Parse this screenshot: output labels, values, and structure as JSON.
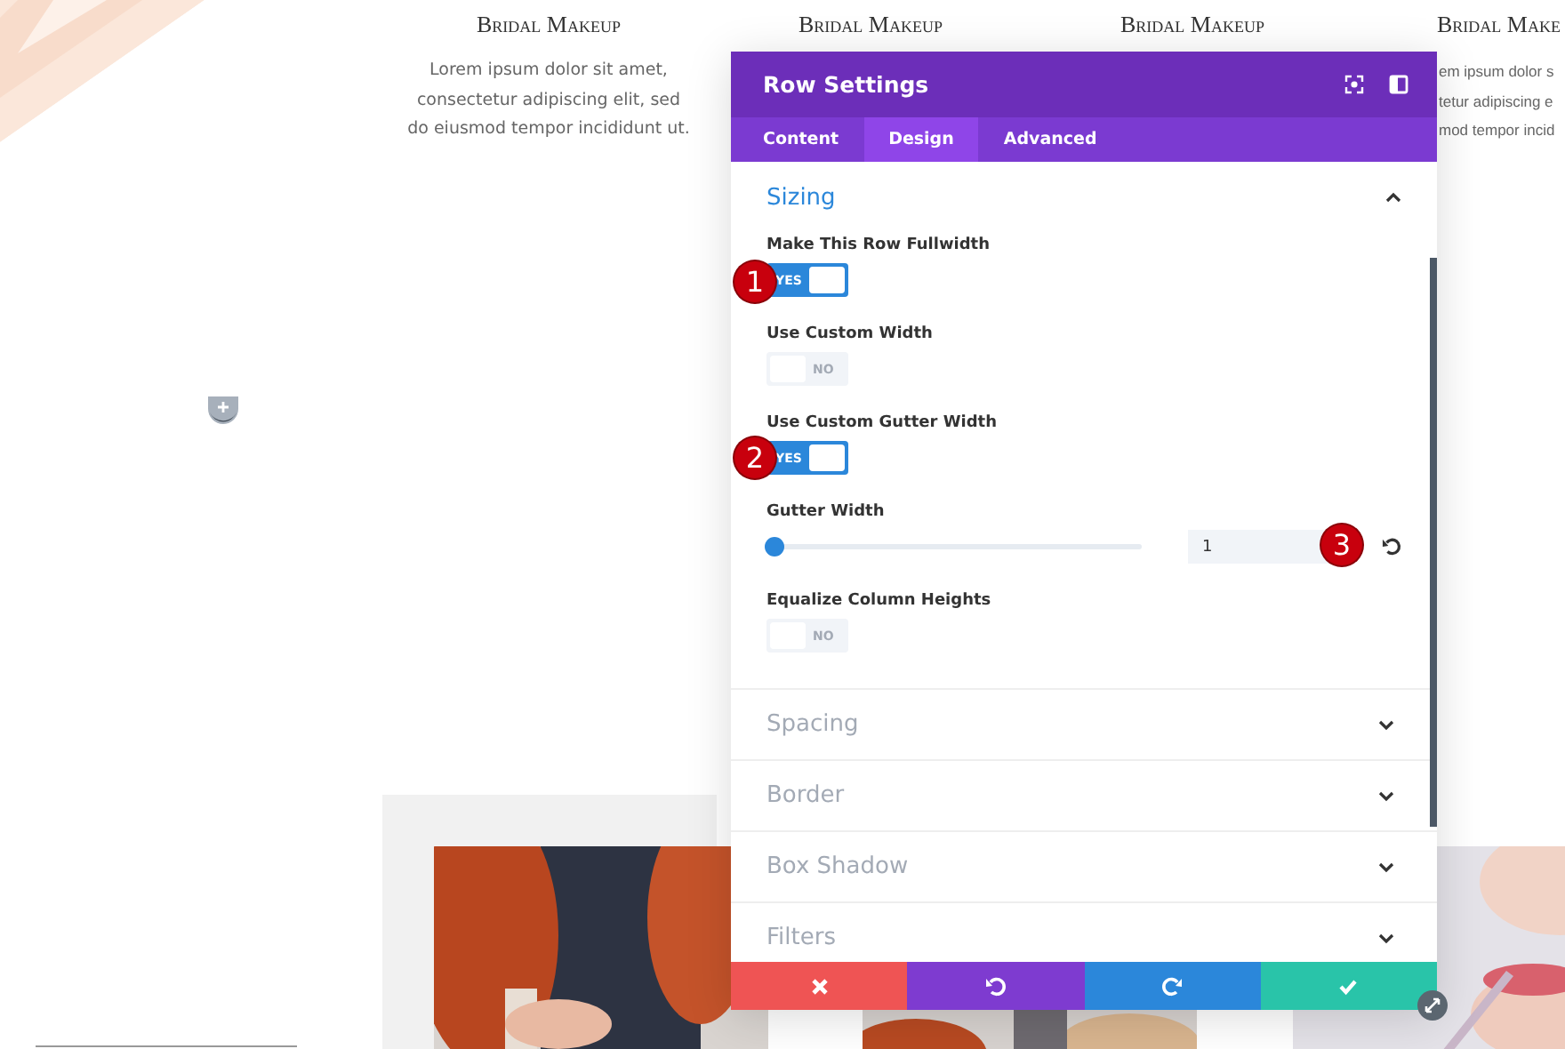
{
  "page": {
    "columns": [
      {
        "heading": "Bridal Makeup",
        "text": "Lorem ipsum dolor sit amet, consectetur adipiscing elit, sed do eiusmod tempor incididunt ut."
      },
      {
        "heading": "Bridal Makeup"
      },
      {
        "heading": "Bridal Makeup"
      },
      {
        "heading": "Bridal Make",
        "lines": [
          "em ipsum dolor s",
          "tetur adipiscing e",
          "mod tempor incid"
        ]
      }
    ]
  },
  "modal": {
    "title": "Row Settings",
    "tabs": [
      {
        "label": "Content",
        "selected": false
      },
      {
        "label": "Design",
        "selected": true
      },
      {
        "label": "Advanced",
        "selected": false
      }
    ],
    "sections": [
      {
        "title": "Sizing",
        "expanded": true,
        "settings": [
          {
            "kind": "toggle",
            "label": "Make This Row Fullwidth",
            "on": true,
            "state_text": "YES"
          },
          {
            "kind": "toggle",
            "label": "Use Custom Width",
            "on": false,
            "state_text": "NO"
          },
          {
            "kind": "toggle",
            "label": "Use Custom Gutter Width",
            "on": true,
            "state_text": "YES"
          },
          {
            "kind": "slider",
            "label": "Gutter Width",
            "level": 0,
            "value": "1"
          },
          {
            "kind": "toggle",
            "label": "Equalize Column Heights",
            "on": false,
            "state_text": "NO"
          }
        ]
      },
      {
        "title": "Spacing",
        "expanded": false
      },
      {
        "title": "Border",
        "expanded": false
      },
      {
        "title": "Box Shadow",
        "expanded": false
      },
      {
        "title": "Filters",
        "expanded": false
      }
    ],
    "footer_buttons": [
      {
        "kind": "cancel"
      },
      {
        "kind": "undo"
      },
      {
        "kind": "redo"
      },
      {
        "kind": "save"
      }
    ]
  },
  "annotations": [
    "1",
    "2",
    "3"
  ]
}
